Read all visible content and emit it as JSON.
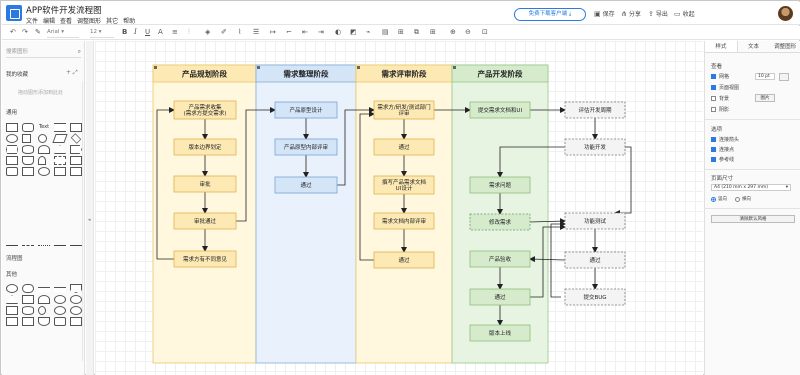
{
  "app": {
    "title": "APP软件开发流程图",
    "menu": [
      "文件",
      "编辑",
      "查看",
      "调整图形",
      "其它",
      "帮助"
    ],
    "download_label": "免费下载客户端",
    "save_label": "保存",
    "share_label": "分享",
    "export_label": "导出",
    "collapse_label": "收起"
  },
  "toolbar": {
    "font": "Arial",
    "font_size": "12"
  },
  "sidebar": {
    "search_placeholder": "搜索图形",
    "favorites_title": "我的收藏",
    "favorites_hint": "拖动图形添加到此处",
    "general_title": "通用",
    "text_shape": "Text",
    "flowchart_title": "流程图",
    "other_title": "其他"
  },
  "diagram": {
    "lanes": [
      {
        "title": "产品规划阶段",
        "fill": "#fff8df",
        "head": "#fde9b4",
        "stroke": "#e8c66a"
      },
      {
        "title": "需求整理阶段",
        "fill": "#e8f1fc",
        "head": "#d4e5f8",
        "stroke": "#86acd6"
      },
      {
        "title": "需求评审阶段",
        "fill": "#fff8df",
        "head": "#fde9b4",
        "stroke": "#e8c66a"
      },
      {
        "title": "产品开发阶段",
        "fill": "#e7f4e2",
        "head": "#d5ebcb",
        "stroke": "#9ac78a"
      }
    ],
    "nodes": {
      "collect": "产品需求收集\n(需求方提交需求)",
      "scope": "版本边界划定",
      "review": "审批",
      "approved1": "审批通过",
      "disagree": "需求方有不同意见",
      "proto": "产品原型设计",
      "proto_review": "产品原型内部评审",
      "pass2": "通过",
      "ui_req": "需求方/研发/测试部门\n评审",
      "pass3": "通过",
      "write_doc": "撰写产品需求文档\nUI设计",
      "doc_review": "需求文档内部评审",
      "pass4": "通过",
      "submit": "提交需求文档和UI",
      "eval": "评估开发周期",
      "devtest": "功能开发",
      "req_issue": "需求问题",
      "modify": "修改需求",
      "test": "功能测试",
      "acceptance": "产品验收",
      "pass5": "通过",
      "pass6": "通过",
      "bug": "提交BUG",
      "release": "版本上线"
    }
  },
  "panel": {
    "tabs": [
      "样式",
      "文本",
      "调整图形"
    ],
    "view_title": "查看",
    "grid_label": "网格",
    "grid_size": "10 pt",
    "page_view_label": "页面视图",
    "background_label": "背景",
    "shadow_label": "阴影",
    "image_button": "图片",
    "options_title": "选项",
    "connection_arrows": "连接箭头",
    "connection_points": "连接点",
    "guides": "参考线",
    "page_size_title": "页面尺寸",
    "page_size": "A4 (210 mm x 297 mm)",
    "portrait": "竖向",
    "landscape": "横向",
    "clear_button": "清除默认风格"
  }
}
